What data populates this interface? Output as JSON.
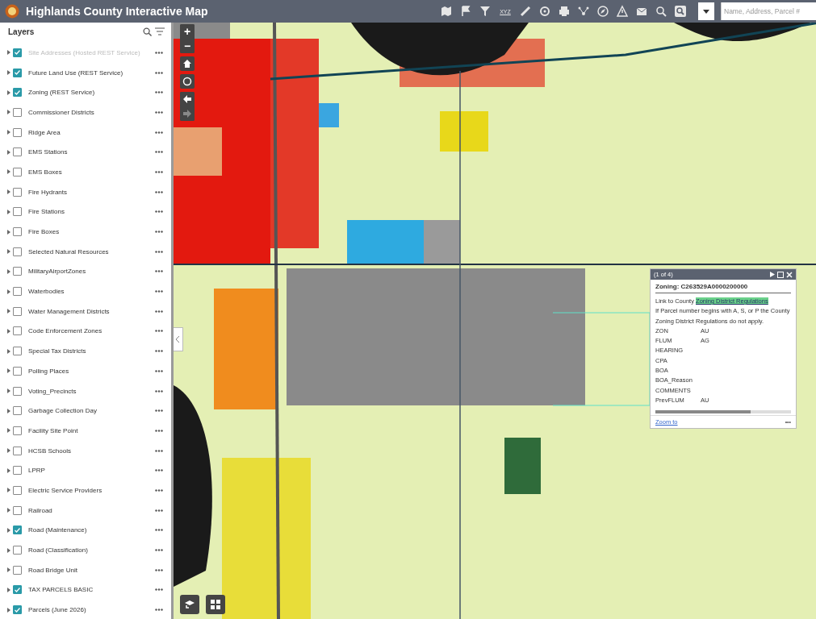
{
  "header": {
    "title": "Highlands County Interactive Map",
    "toolbar_text": "XYZ",
    "search": {
      "placeholder": "Name, Address, Parcel #"
    }
  },
  "layers": {
    "title": "Layers",
    "items": [
      {
        "label": "Site Addresses (Hosted REST Service)",
        "checked": true,
        "disabled": true
      },
      {
        "label": "Future Land Use (REST Service)",
        "checked": true,
        "disabled": false
      },
      {
        "label": "Zoning (REST Service)",
        "checked": true,
        "disabled": false
      },
      {
        "label": "Commissioner Districts",
        "checked": false,
        "disabled": false
      },
      {
        "label": "Ridge Area",
        "checked": false,
        "disabled": false
      },
      {
        "label": "EMS Stations",
        "checked": false,
        "disabled": false
      },
      {
        "label": "EMS Boxes",
        "checked": false,
        "disabled": false
      },
      {
        "label": "Fire Hydrants",
        "checked": false,
        "disabled": false
      },
      {
        "label": "Fire Stations",
        "checked": false,
        "disabled": false
      },
      {
        "label": "Fire Boxes",
        "checked": false,
        "disabled": false
      },
      {
        "label": "Selected Natural Resources",
        "checked": false,
        "disabled": false
      },
      {
        "label": "MilitaryAirportZones",
        "checked": false,
        "disabled": false
      },
      {
        "label": "Waterbodies",
        "checked": false,
        "disabled": false
      },
      {
        "label": "Water Management Districts",
        "checked": false,
        "disabled": false
      },
      {
        "label": "Code Enforcement Zones",
        "checked": false,
        "disabled": false
      },
      {
        "label": "Special Tax Districts",
        "checked": false,
        "disabled": false
      },
      {
        "label": "Polling Places",
        "checked": false,
        "disabled": false
      },
      {
        "label": "Voting_Precincts",
        "checked": false,
        "disabled": false
      },
      {
        "label": "Garbage Collection Day",
        "checked": false,
        "disabled": false
      },
      {
        "label": "Facility Site Point",
        "checked": false,
        "disabled": false
      },
      {
        "label": "HCSB Schools",
        "checked": false,
        "disabled": false
      },
      {
        "label": "LPRP",
        "checked": false,
        "disabled": false
      },
      {
        "label": "Electric Service Providers",
        "checked": false,
        "disabled": false
      },
      {
        "label": "Railroad",
        "checked": false,
        "disabled": false
      },
      {
        "label": "Road (Maintenance)",
        "checked": true,
        "disabled": false
      },
      {
        "label": "Road (Classification)",
        "checked": false,
        "disabled": false
      },
      {
        "label": "Road Bridge Unit",
        "checked": false,
        "disabled": false
      },
      {
        "label": "TAX PARCELS BASIC",
        "checked": true,
        "disabled": false
      },
      {
        "label": "Parcels (June 2026)",
        "checked": true,
        "disabled": false
      }
    ]
  },
  "map_controls": {
    "zoom_in": "+",
    "zoom_out": "−"
  },
  "popup": {
    "counter": "(1 of 4)",
    "title": "Zoning: C263529A0000200000",
    "link_prefix": "Link to County",
    "link": "Zoning District Regulations",
    "note": "If Parcel number begins with A, S, or P the County Zoning District Regulations do not apply.",
    "fields": [
      {
        "name": "ZON",
        "value": "AU"
      },
      {
        "name": "FLUM",
        "value": "AG"
      },
      {
        "name": "HEARING"
      },
      {
        "name": "CPA"
      },
      {
        "name": "BOA"
      },
      {
        "name": "BOA_Reason"
      },
      {
        "name": "COMMENTS"
      },
      {
        "name": "PrevFLUM",
        "value": "AU"
      }
    ],
    "footer_link": "Zoom to",
    "more": "•••"
  }
}
